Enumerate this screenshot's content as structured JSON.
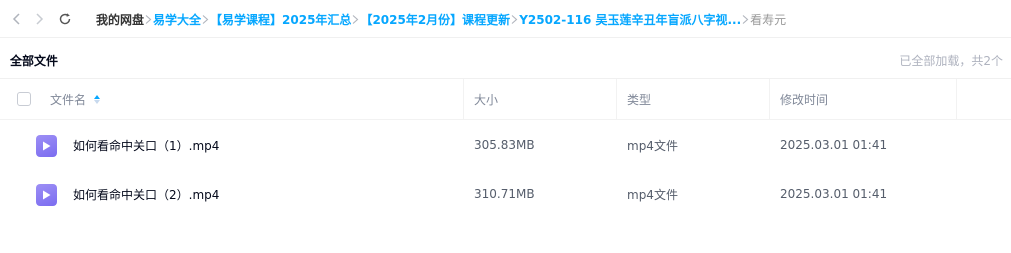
{
  "breadcrumb": {
    "items": [
      {
        "label": "我的网盘"
      },
      {
        "label": "易学大全"
      },
      {
        "label": "【易学课程】2025年汇总"
      },
      {
        "label": "【2025年2月份】课程更新"
      },
      {
        "label": "Y2502-116 吴玉莲辛丑年盲派八字视..."
      },
      {
        "label": "看寿元"
      }
    ]
  },
  "header": {
    "title": "全部文件",
    "status": "已全部加载，共2个"
  },
  "table": {
    "columns": {
      "name": "文件名",
      "size": "大小",
      "type": "类型",
      "modified": "修改时间"
    },
    "rows": [
      {
        "name": "如何看命中关口（1）.mp4",
        "size": "305.83MB",
        "type": "mp4文件",
        "modified": "2025.03.01 01:41"
      },
      {
        "name": "如何看命中关口（2）.mp4",
        "size": "310.71MB",
        "type": "mp4文件",
        "modified": "2025.03.01 01:41"
      }
    ]
  },
  "icons": {
    "back": "chevron-left-icon",
    "forward": "chevron-right-icon",
    "refresh": "refresh-icon",
    "file": "video-file-icon",
    "sort": "sort-ascending-icon"
  },
  "colors": {
    "accent": "#06a7ff",
    "file_icon": "#8677f2"
  }
}
